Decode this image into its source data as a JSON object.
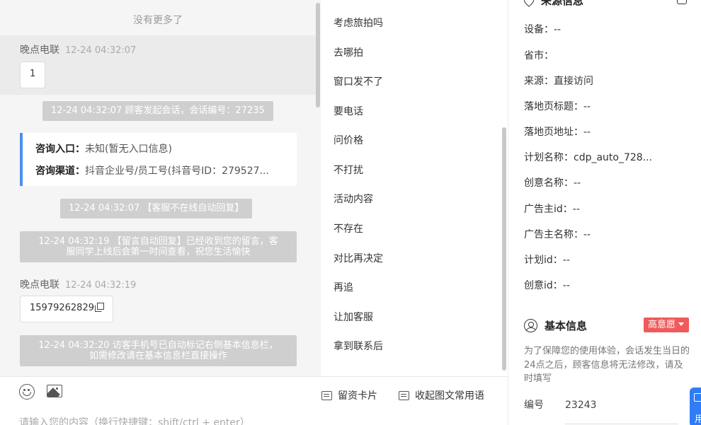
{
  "chat": {
    "no_more": "没有更多了",
    "messages": [
      {
        "sender": "晚点电联",
        "time": "12-24 04:32:07",
        "content": "1"
      },
      {
        "sender": "晚点电联",
        "time": "12-24 04:32:19",
        "content": "15979262829"
      }
    ],
    "system": {
      "session_start": "12-24 04:32:07 顾客发起会话，会话编号：27235",
      "offline_reply": "12-24 04:32:07 【客服不在线自动回复】",
      "leave_msg_reply": "12-24 04:32:19 【留言自动回复】已经收到您的留言，客服同学上线后会第一时间查看，祝您生活愉快",
      "phone_marked": "12-24 04:32:20 访客手机号已自动标记右侧基本信息栏，如需修改请在基本信息栏直接操作"
    },
    "entry_card": {
      "entry_label": "咨询入口：",
      "entry_value": "未知(暂无入口信息)",
      "channel_label": "咨询渠道：",
      "channel_value": "抖音企业号/员工号(抖音号ID：279527..."
    }
  },
  "quick_replies": [
    "考虑旅拍吗",
    "去哪拍",
    "窗口发不了",
    "要电话",
    "问价格",
    "不打扰",
    "活动内容",
    "不存在",
    "对比再决定",
    "再追",
    "让加客服",
    "拿到联系后"
  ],
  "toolbar": {
    "lead_card": "留资卡片",
    "favorite_phrases": "收起图文常用语",
    "input_placeholder": "请输入您的内容（换行快捷键：shift/ctrl + enter）"
  },
  "panel": {
    "source_title": "来源信息",
    "source_fields": [
      {
        "label": "设备：",
        "value": "--"
      },
      {
        "label": "省市：",
        "value": ""
      },
      {
        "label": "来源：",
        "value": "直接访问"
      },
      {
        "label": "落地页标题：",
        "value": "--"
      },
      {
        "label": "落地页地址：",
        "value": "--"
      },
      {
        "label": "计划名称：",
        "value": "cdp_auto_728..."
      },
      {
        "label": "创意名称：",
        "value": "--"
      },
      {
        "label": "广告主id：",
        "value": "--"
      },
      {
        "label": "广告主名称：",
        "value": "--"
      },
      {
        "label": "计划id：",
        "value": "--"
      },
      {
        "label": "创意id：",
        "value": "--"
      }
    ],
    "basic_title": "基本信息",
    "intent_badge": "高意愿",
    "notice": "为了保障您的使用体验，会话发生当日的24点之后，顾客信息将无法修改，请及时填写",
    "number_label": "编号",
    "number_value": "23243",
    "float_label": "用"
  }
}
